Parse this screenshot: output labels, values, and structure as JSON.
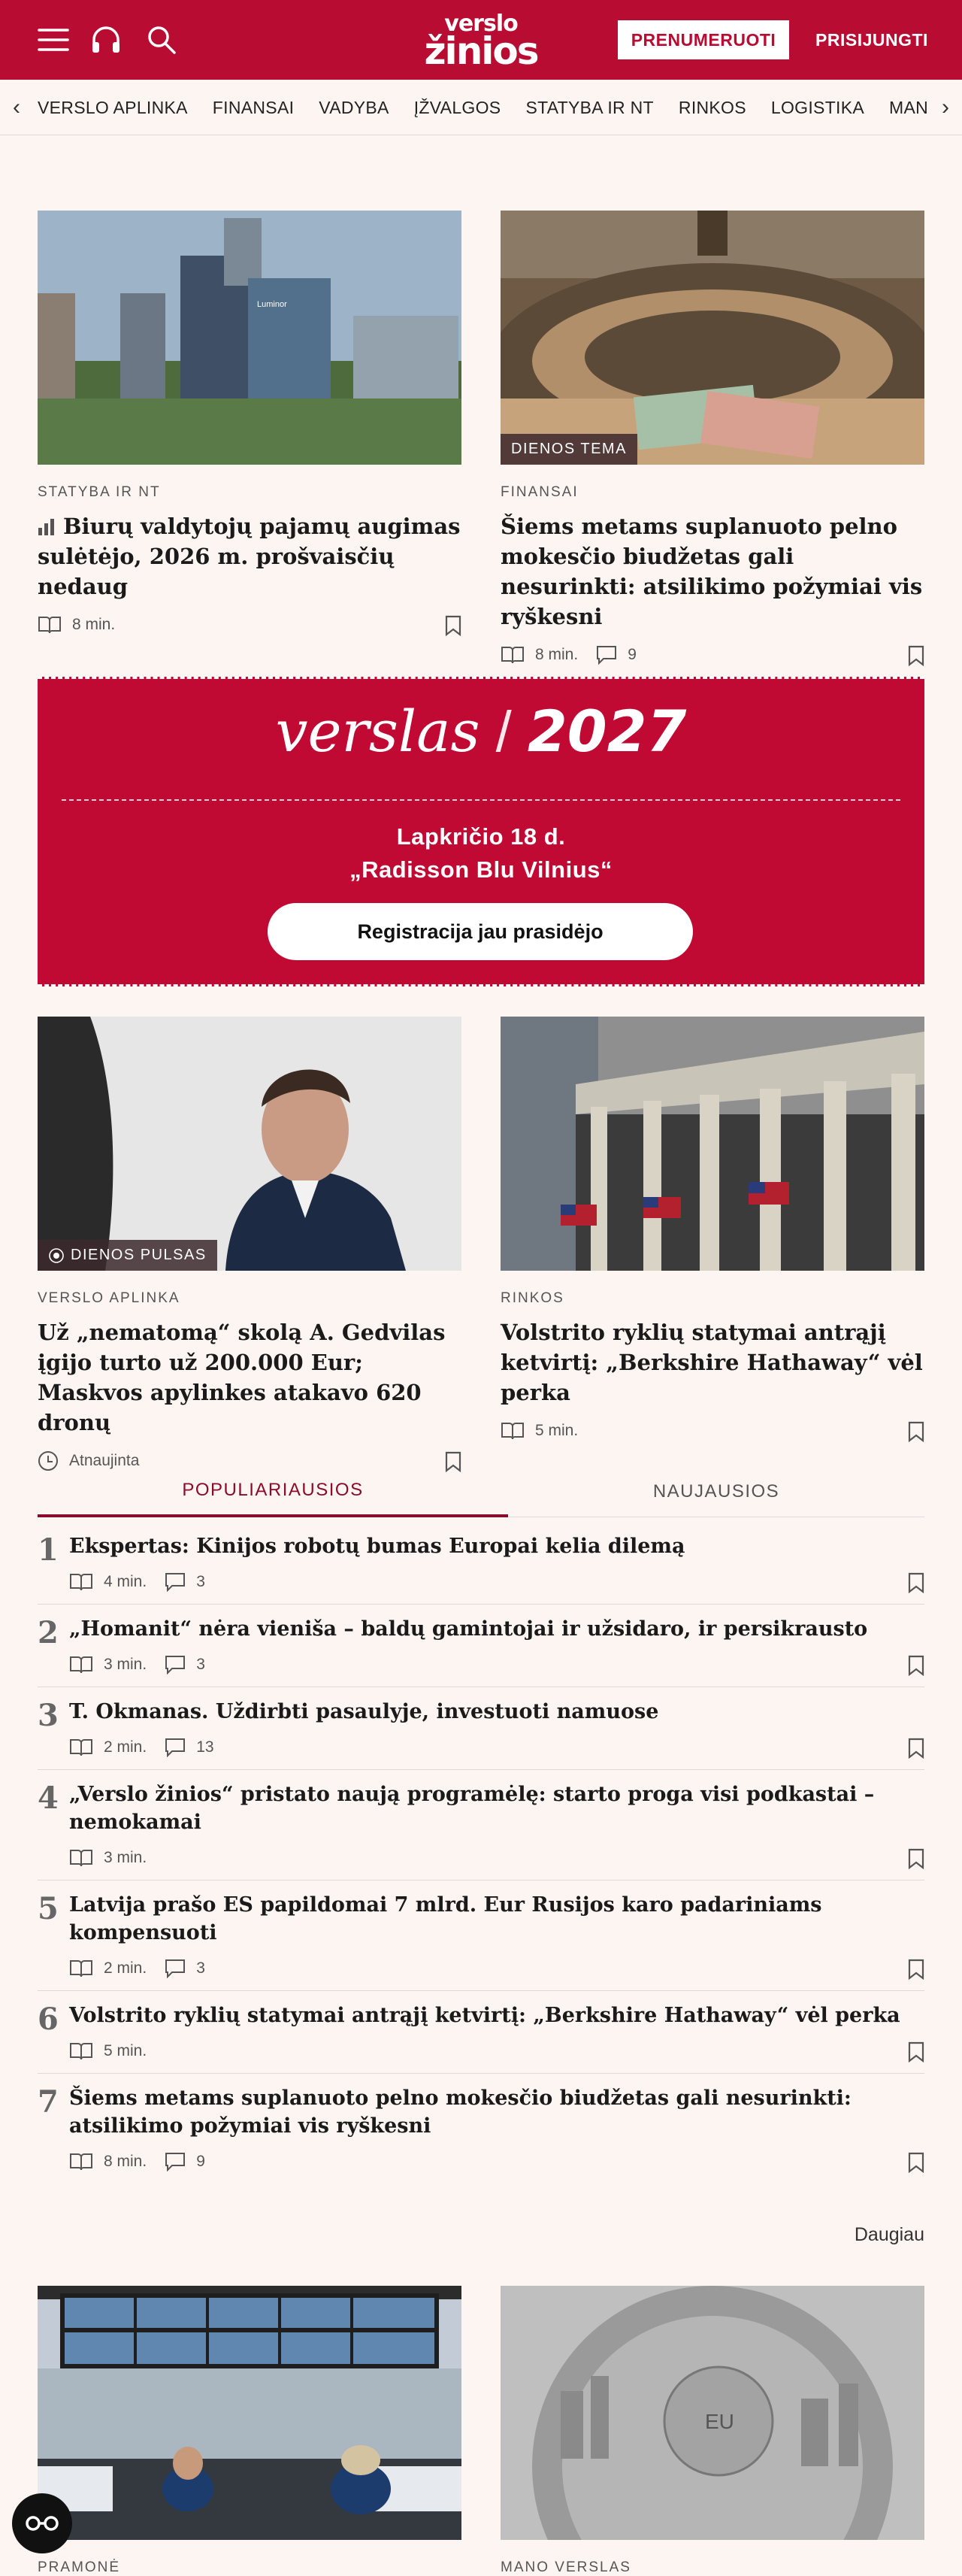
{
  "header": {
    "logo_line1": "verslo",
    "logo_line2": "žinios",
    "subscribe_label": "PRENUMERUOTI",
    "login_label": "PRISIJUNGTI"
  },
  "nav": {
    "items": [
      "VERSLO APLINKA",
      "FINANSAI",
      "VADYBA",
      "ĮŽVALGOS",
      "STATYBA IR NT",
      "RINKOS",
      "LOGISTIKA",
      "MANO VERSLAS"
    ]
  },
  "top_articles": [
    {
      "kicker": "STATYBA IR NT",
      "title": "Biurų valdytojų pajamų augimas sulėtėjo, 2026 m. prošvaisčių nedaug",
      "read_time": "8 min.",
      "comments": "",
      "badge": ""
    },
    {
      "kicker": "FINANSAI",
      "title": "Šiems metams suplanuoto pelno mokesčio biudžetas gali nesurinkti: atsilikimo požymiai vis ryškesni",
      "read_time": "8 min.",
      "comments": "9",
      "badge": "DIENOS TEMA"
    }
  ],
  "banner": {
    "brand_word": "verslas",
    "brand_year": "2027",
    "date_line": "Lapkričio 18 d.",
    "venue_line": "„Radisson Blu Vilnius“",
    "cta": "Registracija jau prasidėjo"
  },
  "mid_articles": [
    {
      "kicker": "VERSLO APLINKA",
      "title": "Už „nematomą“ skolą A. Gedvilas įgijo turto už 200.000 Eur; Maskvos apylinkes atakavo 620 dronų",
      "updated": "Atnaujinta",
      "badge": "DIENOS PULSAS"
    },
    {
      "kicker": "RINKOS",
      "title": "Volstrito ryklių statymai antrąjį ketvirtį: „Berkshire Hathaway“ vėl perka",
      "read_time": "5 min."
    }
  ],
  "tabs": {
    "popular": "POPULIARIAUSIOS",
    "latest": "NAUJAUSIOS"
  },
  "popular": [
    {
      "n": "1",
      "title": "Ekspertas: Kinijos robotų bumas Europai kelia dilemą",
      "read_time": "4 min.",
      "comments": "3"
    },
    {
      "n": "2",
      "title": "„Homanit“ nėra vieniša – baldų gamintojai ir užsidaro, ir persikrausto",
      "read_time": "3 min.",
      "comments": "3"
    },
    {
      "n": "3",
      "title": "T. Okmanas. Uždirbti pasaulyje, investuoti namuose",
      "read_time": "2 min.",
      "comments": "13"
    },
    {
      "n": "4",
      "title": "„Verslo žinios“ pristato naują programėlę: starto proga visi podkastai – nemokamai",
      "read_time": "3 min.",
      "comments": ""
    },
    {
      "n": "5",
      "title": "Latvija prašo ES papildomai 7 mlrd. Eur Rusijos karo padariniams kompensuoti",
      "read_time": "2 min.",
      "comments": "3"
    },
    {
      "n": "6",
      "title": "Volstrito ryklių statymai antrąjį ketvirtį: „Berkshire Hathaway“ vėl perka",
      "read_time": "5 min.",
      "comments": ""
    },
    {
      "n": "7",
      "title": "Šiems metams suplanuoto pelno mokesčio biudžetas gali nesurinkti: atsilikimo požymiai vis ryškesni",
      "read_time": "8 min.",
      "comments": "9"
    }
  ],
  "more_label": "Daugiau",
  "bottom_articles": [
    {
      "kicker": "PRAMONĖ"
    },
    {
      "kicker": "MANO VERSLAS"
    }
  ]
}
